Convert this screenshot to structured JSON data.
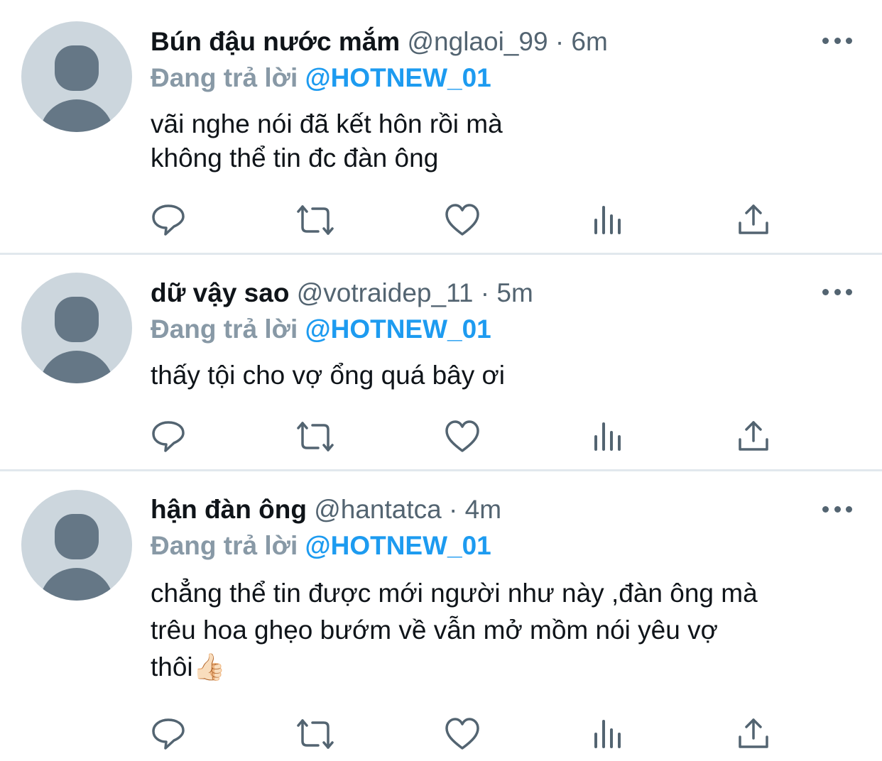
{
  "colors": {
    "accent": "#1d9bf0",
    "secondary_text": "#536471",
    "muted_label": "#8899a6",
    "avatar_bg": "#ccd6dd",
    "avatar_fg": "#657786",
    "divider": "#e1e8ed"
  },
  "icons": {
    "reply": "reply-icon",
    "retweet": "retweet-icon",
    "like": "heart-icon",
    "analytics": "analytics-icon",
    "share": "share-icon",
    "more": "more-horizontal-icon",
    "avatar": "default-avatar-icon"
  },
  "tweets": [
    {
      "name": "Bún đậu nước mắm",
      "handle": "@nglaoi_99",
      "separator": "·",
      "time": "6m",
      "reply_label": "Đang trả lời",
      "reply_target": "@HOTNEW_01",
      "lines": [
        "vãi nghe nói đã kết hôn rồi mà",
        "không thể tin đc đàn ông"
      ]
    },
    {
      "name": "dữ vậy sao",
      "handle": "@votraidep_11",
      "separator": "·",
      "time": "5m",
      "reply_label": "Đang trả lời",
      "reply_target": "@HOTNEW_01",
      "lines": [
        "thấy tội cho vợ ổng quá bây ơi"
      ]
    },
    {
      "name": "hận đàn ông",
      "handle": "@hantatca",
      "separator": "·",
      "time": "4m",
      "reply_label": "Đang trả lời",
      "reply_target": "@HOTNEW_01",
      "lines": [
        "chẳng thể tin được mới người như này ,đàn ông mà",
        "trêu hoa ghẹo bướm  về vẫn mở mồm nói yêu vợ",
        "thôi👍🏻"
      ]
    }
  ]
}
